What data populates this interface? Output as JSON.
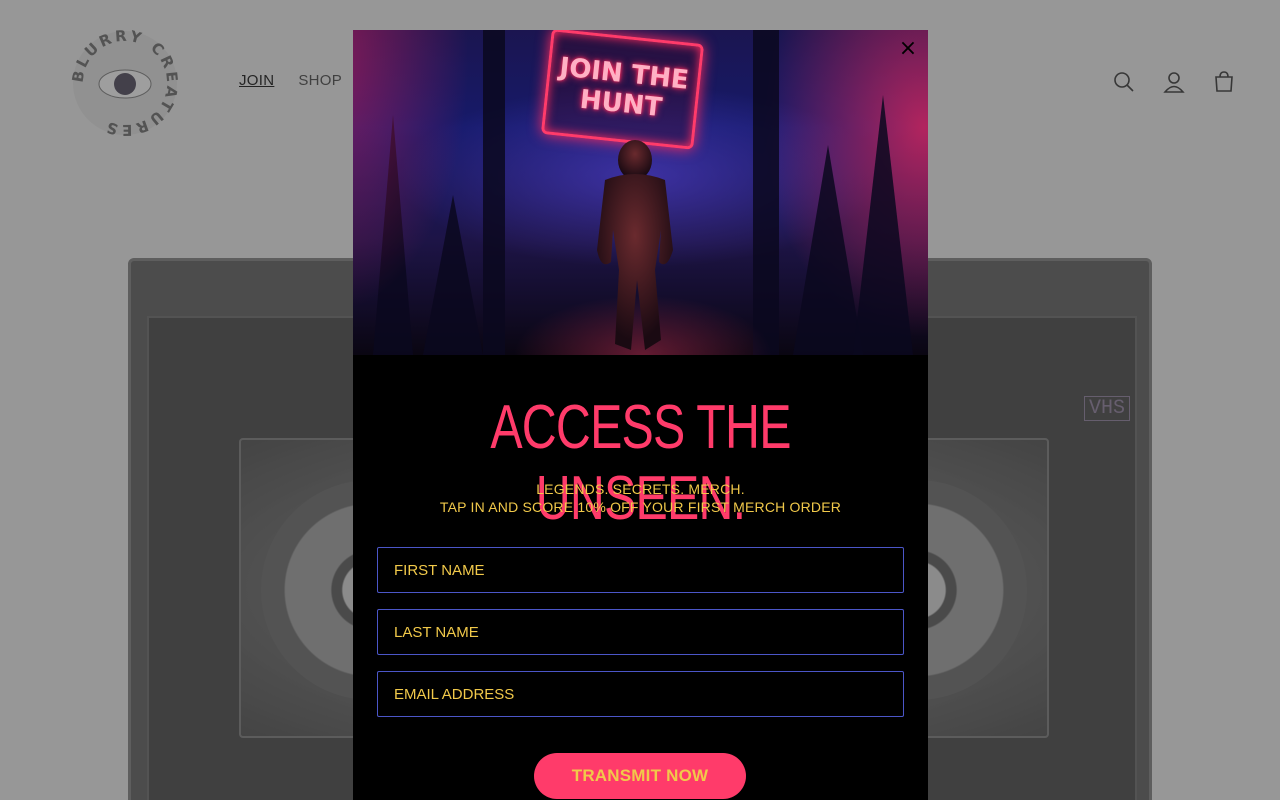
{
  "brand": {
    "name": "BLURRY CREATURES"
  },
  "nav": {
    "join": "JOIN",
    "shop": "SHOP"
  },
  "header_icons": [
    "search-icon",
    "account-icon",
    "cart-icon"
  ],
  "background": {
    "tape_label": "VHS"
  },
  "modal": {
    "sign_text_line1": "JOIN THE",
    "sign_text_line2": "HUNT",
    "headline": "ACCESS THE UNSEEN.",
    "sub_line1": "LEGENDS. SECRETS. MERCH.",
    "sub_line2": "TAP IN AND SCORE 10% OFF YOUR FIRST MERCH ORDER",
    "first_name_placeholder": "FIRST NAME",
    "last_name_placeholder": "LAST NAME",
    "email_placeholder": "EMAIL ADDRESS",
    "submit_label": "TRANSMIT NOW",
    "close_label": "×"
  },
  "colors": {
    "accent": "#ff3b6a",
    "text_yellow": "#f1c94a",
    "field_border": "#4b56c8"
  }
}
